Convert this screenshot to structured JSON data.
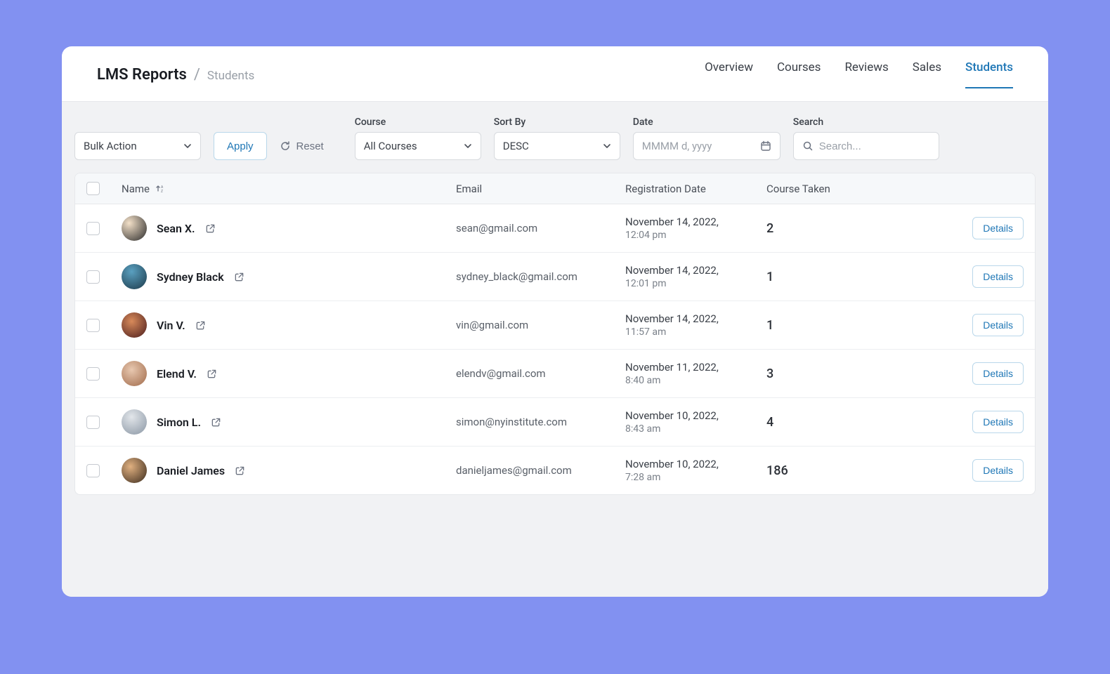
{
  "header": {
    "title": "LMS Reports",
    "separator": "/",
    "subtitle": "Students",
    "tabs": [
      {
        "label": "Overview",
        "active": false
      },
      {
        "label": "Courses",
        "active": false
      },
      {
        "label": "Reviews",
        "active": false
      },
      {
        "label": "Sales",
        "active": false
      },
      {
        "label": "Students",
        "active": true
      }
    ]
  },
  "filters": {
    "bulk_action": {
      "value": "Bulk Action"
    },
    "apply_label": "Apply",
    "reset_label": "Reset",
    "course": {
      "label": "Course",
      "value": "All Courses"
    },
    "sort": {
      "label": "Sort By",
      "value": "DESC"
    },
    "date": {
      "label": "Date",
      "placeholder": "MMMM d, yyyy"
    },
    "search": {
      "label": "Search",
      "placeholder": "Search..."
    }
  },
  "table": {
    "columns": {
      "name": "Name",
      "email": "Email",
      "registration": "Registration Date",
      "course_taken": "Course Taken"
    },
    "details_label": "Details",
    "rows": [
      {
        "name": "Sean X.",
        "email": "sean@gmail.com",
        "date": "November 14, 2022,",
        "time": "12:04 pm",
        "courses": "2"
      },
      {
        "name": "Sydney Black",
        "email": "sydney_black@gmail.com",
        "date": "November 14, 2022,",
        "time": "12:01 pm",
        "courses": "1"
      },
      {
        "name": "Vin V.",
        "email": "vin@gmail.com",
        "date": "November 14, 2022,",
        "time": "11:57 am",
        "courses": "1"
      },
      {
        "name": "Elend V.",
        "email": "elendv@gmail.com",
        "date": "November 11, 2022,",
        "time": "8:40 am",
        "courses": "3"
      },
      {
        "name": "Simon L.",
        "email": "simon@nyinstitute.com",
        "date": "November 10, 2022,",
        "time": "8:43 am",
        "courses": "4"
      },
      {
        "name": "Daniel James",
        "email": "danieljames@gmail.com",
        "date": "November 10, 2022,",
        "time": "7:28 am",
        "courses": "186"
      }
    ]
  }
}
